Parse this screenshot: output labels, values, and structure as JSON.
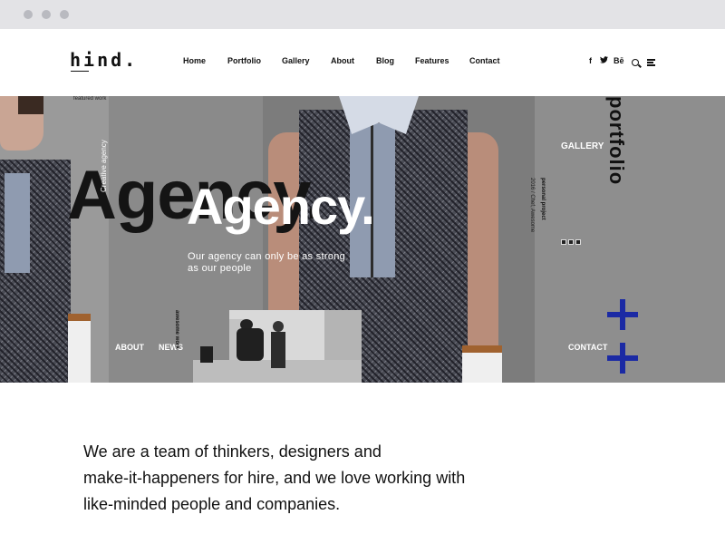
{
  "header": {
    "logo": "hind.",
    "nav": [
      {
        "label": "Home"
      },
      {
        "label": "Portfolio"
      },
      {
        "label": "Gallery"
      },
      {
        "label": "About"
      },
      {
        "label": "Blog"
      },
      {
        "label": "Features"
      },
      {
        "label": "Contact"
      }
    ],
    "social": [
      {
        "label": "f",
        "icon": "facebook-icon"
      },
      {
        "label": "🐦",
        "icon": "twitter-icon"
      },
      {
        "label": "Bē",
        "icon": "behance-icon"
      }
    ],
    "search_icon": "search-icon",
    "menu_icon": "menu-icon"
  },
  "hero": {
    "featured": "featured work",
    "creative": "Creative agency",
    "bg_title": "Agency.",
    "title": "Agency.",
    "subtitle_1": "Our agency can only be as strong",
    "subtitle_2": "as our people",
    "personal": "personal project",
    "personal_sub": "2016 / Chef, Awesome",
    "portfolio": "portfolio",
    "gallery": "GALLERY",
    "about": "ABOUT",
    "news": "NEWS",
    "contact": "CONTACT",
    "awesome": "awesome work",
    "accent_color": "#1b2aa4"
  },
  "intro": {
    "line1": "We are a team of thinkers, designers and",
    "line2": "make-it-happeners for hire, and we love working with",
    "line3": "like-minded people and companies."
  }
}
